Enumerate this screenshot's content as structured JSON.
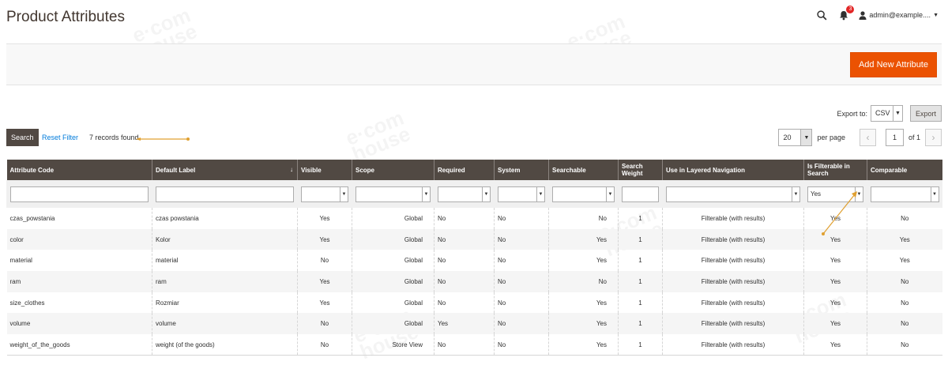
{
  "page": {
    "title": "Product Attributes"
  },
  "header": {
    "notifications_count": "3",
    "user_name": "admin@example...."
  },
  "toolbar": {
    "add_new_label": "Add New Attribute"
  },
  "export": {
    "label": "Export to:",
    "format": "CSV",
    "button_label": "Export"
  },
  "grid_actions": {
    "search_label": "Search",
    "reset_label": "Reset Filter",
    "records_found": "7 records found"
  },
  "pager": {
    "limit": "20",
    "per_page_label": "per page",
    "current_page": "1",
    "of_label": "of 1"
  },
  "columns": [
    "Attribute Code",
    "Default Label",
    "Visible",
    "Scope",
    "Required",
    "System",
    "Searchable",
    "Search Weight",
    "Use in Layered Navigation",
    "Is Filterable in Search",
    "Comparable"
  ],
  "filters": {
    "is_filterable_in_search": "Yes"
  },
  "rows": [
    {
      "code": "czas_powstania",
      "label": "czas powstania",
      "visible": "Yes",
      "scope": "Global",
      "required": "No",
      "system": "No",
      "searchable": "No",
      "weight": "1",
      "layered": "Filterable (with results)",
      "filterable_search": "Yes",
      "comparable": "No"
    },
    {
      "code": "color",
      "label": "Kolor",
      "visible": "Yes",
      "scope": "Global",
      "required": "No",
      "system": "No",
      "searchable": "Yes",
      "weight": "1",
      "layered": "Filterable (with results)",
      "filterable_search": "Yes",
      "comparable": "Yes"
    },
    {
      "code": "material",
      "label": "material",
      "visible": "No",
      "scope": "Global",
      "required": "No",
      "system": "No",
      "searchable": "Yes",
      "weight": "1",
      "layered": "Filterable (with results)",
      "filterable_search": "Yes",
      "comparable": "Yes"
    },
    {
      "code": "ram",
      "label": "ram",
      "visible": "Yes",
      "scope": "Global",
      "required": "No",
      "system": "No",
      "searchable": "No",
      "weight": "1",
      "layered": "Filterable (with results)",
      "filterable_search": "Yes",
      "comparable": "No"
    },
    {
      "code": "size_clothes",
      "label": "Rozmiar",
      "visible": "Yes",
      "scope": "Global",
      "required": "No",
      "system": "No",
      "searchable": "Yes",
      "weight": "1",
      "layered": "Filterable (with results)",
      "filterable_search": "Yes",
      "comparable": "No"
    },
    {
      "code": "volume",
      "label": "volume",
      "visible": "No",
      "scope": "Global",
      "required": "Yes",
      "system": "No",
      "searchable": "Yes",
      "weight": "1",
      "layered": "Filterable (with results)",
      "filterable_search": "Yes",
      "comparable": "No"
    },
    {
      "code": "weight_of_the_goods",
      "label": "weight (of the goods)",
      "visible": "No",
      "scope": "Store View",
      "required": "No",
      "system": "No",
      "searchable": "Yes",
      "weight": "1",
      "layered": "Filterable (with results)",
      "filterable_search": "Yes",
      "comparable": "No"
    }
  ],
  "watermark": "e-com.house",
  "colors": {
    "accent_orange": "#eb5202",
    "header_dark": "#514943",
    "link_blue": "#007bdb",
    "annotation": "#e0a030"
  }
}
